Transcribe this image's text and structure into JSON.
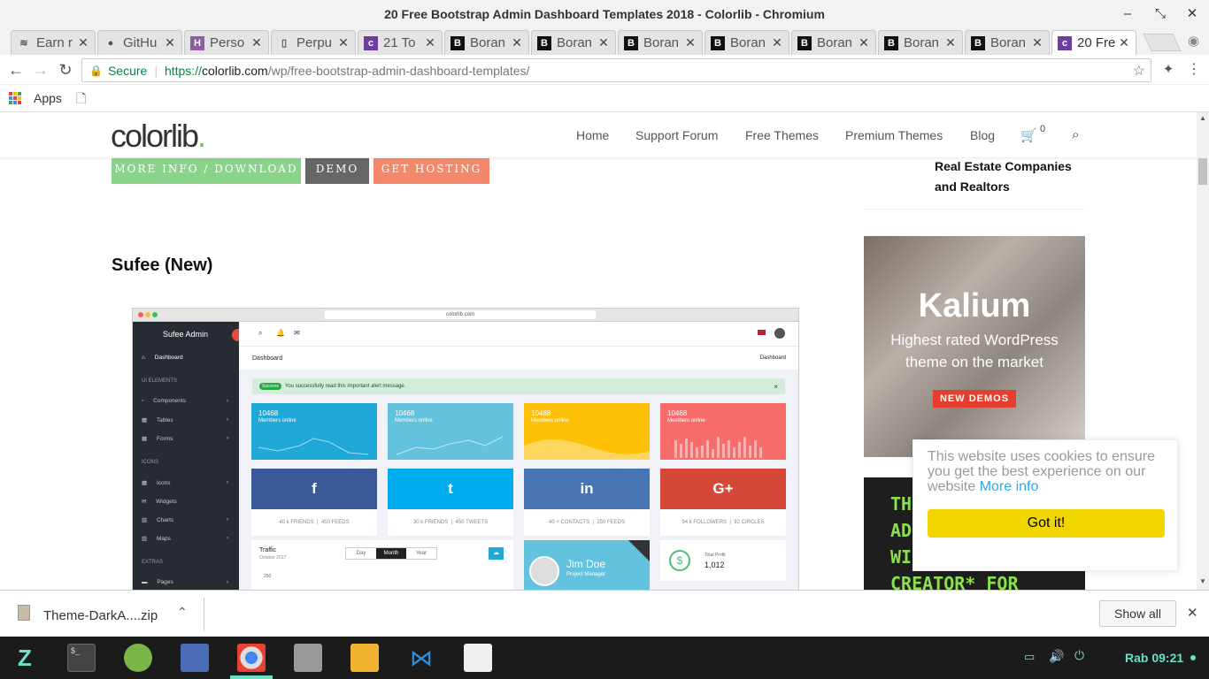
{
  "window": {
    "title": "20 Free Bootstrap Admin Dashboard Templates 2018 - Colorlib - Chromium"
  },
  "tabs": [
    {
      "label": "Earn r",
      "icon": "wifi-icon"
    },
    {
      "label": "GitHu",
      "icon": "github-icon"
    },
    {
      "label": "Perso",
      "icon": "h-icon"
    },
    {
      "label": "Perpu",
      "icon": "page-icon"
    },
    {
      "label": "21 To",
      "icon": "colorlib-icon"
    },
    {
      "label": "Boran",
      "icon": "b-icon"
    },
    {
      "label": "Boran",
      "icon": "b-icon"
    },
    {
      "label": "Boran",
      "icon": "b-icon"
    },
    {
      "label": "Boran",
      "icon": "b-icon"
    },
    {
      "label": "Boran",
      "icon": "b-icon"
    },
    {
      "label": "Boran",
      "icon": "b-icon"
    },
    {
      "label": "Boran",
      "icon": "b-icon"
    },
    {
      "label": "20 Fre",
      "icon": "colorlib-icon",
      "active": true
    }
  ],
  "omnibox": {
    "secure": "Secure",
    "url_scheme": "https://",
    "url_host": "colorlib.com",
    "url_path": "/wp/free-bootstrap-admin-dashboard-templates/"
  },
  "bookmarks": {
    "apps": "Apps"
  },
  "site": {
    "logo": "colorlib",
    "logo_dot": ".",
    "nav": [
      "Home",
      "Support Forum",
      "Free Themes",
      "Premium Themes",
      "Blog"
    ],
    "cart_count": "0",
    "buttons": {
      "more_info": "MORE INFO / DOWNLOAD",
      "demo": "DEMO",
      "hosting": "GET HOSTING"
    },
    "section_title": "Sufee (New)",
    "sidebar_post": {
      "line1": "Real Estate Companies",
      "line2": "and Realtors"
    },
    "ad_kalium": {
      "title": "Kalium",
      "line1": "Highest rated  WordPress",
      "line2": "theme on the market",
      "cta": "NEW DEMOS"
    },
    "ad2": {
      "line1": "TH",
      "line2": "AD",
      "line3": "WI",
      "line4": "CREATOR* FOR"
    }
  },
  "mockup": {
    "url": "colorlib.com",
    "brand": "Sufee Admin",
    "sidebar": {
      "dashboard": "Dashboard",
      "ui_heading": "UI ELEMENTS",
      "components": "Components",
      "tables": "Tables",
      "forms": "Forms",
      "icons_heading": "ICONS",
      "icons": "Icons",
      "widgets": "Widgets",
      "charts": "Charts",
      "maps": "Maps",
      "extras_heading": "EXTRAS",
      "pages": "Pages"
    },
    "page_title": "Dashboard",
    "breadcrumb": "Dashboard",
    "alert": {
      "badge": "Success",
      "text": "You successfully read this important alert message."
    },
    "stats": [
      {
        "value": "10468",
        "label": "Members online",
        "color": "#20a8d8"
      },
      {
        "value": "10468",
        "label": "Members online",
        "color": "#63c2de"
      },
      {
        "value": "10468",
        "label": "Members online",
        "color": "#ffc107"
      },
      {
        "value": "10468",
        "label": "Members online",
        "color": "#f86c6b"
      }
    ],
    "social": [
      {
        "glyph": "f",
        "a": "40 k FRIENDS",
        "b": "450 FEEDS",
        "color": "#3b5998"
      },
      {
        "glyph": "t",
        "a": "30 k FRIENDS",
        "b": "450 TWEETS",
        "color": "#00aced"
      },
      {
        "glyph": "in",
        "a": "40 + CONTACTS",
        "b": "250 FEEDS",
        "color": "#4875b4"
      },
      {
        "glyph": "G+",
        "a": "94 k FOLLOWERS",
        "b": "92 CIRCLES",
        "color": "#d34836"
      }
    ],
    "traffic": {
      "title": "Traffic",
      "sub": "October 2017",
      "opts": [
        "Day",
        "Month",
        "Year"
      ],
      "tick": "250"
    },
    "profile": {
      "name": "Jim Doe",
      "role": "Project Manager"
    },
    "profit": {
      "label": "Total Profit",
      "value": "1,012"
    }
  },
  "cookie": {
    "text": "This website uses cookies to ensure you get the best experience on our website",
    "link": "More info",
    "button": "Got it!"
  },
  "download": {
    "file": "Theme-DarkA....zip",
    "show_all": "Show all"
  },
  "taskbar": {
    "clock": "Rab 09:21"
  }
}
